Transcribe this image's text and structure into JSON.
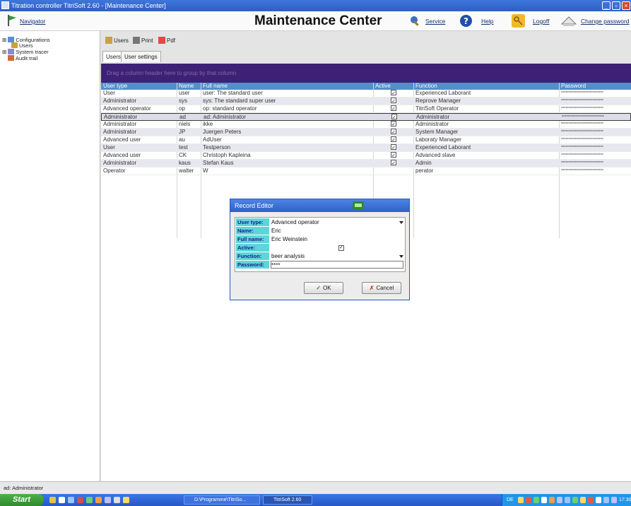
{
  "window": {
    "title": "Titration controller TitriSoft 2.60 - [Maintenance Center]"
  },
  "header": {
    "navigator_label": "Navigator",
    "page_title": "Maintenance Center",
    "service_label": "Service",
    "help_label": "Help",
    "logoff_label": "Logoff",
    "change_password_label": "Change password"
  },
  "nav": {
    "items": [
      {
        "label": "Configurations"
      },
      {
        "label": "Users"
      },
      {
        "label": "System tracer"
      },
      {
        "label": "Audit trail"
      }
    ]
  },
  "toolbar": {
    "users_label": "Users",
    "print_label": "Print",
    "pdf_label": "Pdf"
  },
  "tabs": [
    {
      "label": "Users"
    },
    {
      "label": "User settings"
    }
  ],
  "grid": {
    "group_hint": "Drag a column header here to group by that column",
    "columns": [
      "User type",
      "Name",
      "Full name",
      "Active",
      "Function",
      "Password"
    ],
    "rows": [
      {
        "type": "User",
        "name": "user",
        "full": "user: The standard user",
        "active": true,
        "function": "Experienced Laborant",
        "password": "****************************"
      },
      {
        "type": "Administrator",
        "name": "sys",
        "full": "sys: The standard super user",
        "active": true,
        "function": "Reprove Manager",
        "password": "****************************"
      },
      {
        "type": "Advanced operator",
        "name": "op",
        "full": "op: standard operator",
        "active": true,
        "function": "TitriSoft Operator",
        "password": "****************************"
      },
      {
        "type": "Administrator",
        "name": "ad",
        "full": "ad: Administrator",
        "active": true,
        "function": "Administrator",
        "password": "****************************"
      },
      {
        "type": "Administrator",
        "name": "niels",
        "full": "ikke",
        "active": true,
        "function": "Administrator",
        "password": "****************************"
      },
      {
        "type": "Administrator",
        "name": "JP",
        "full": "Juergen Peters",
        "active": true,
        "function": "System Manager",
        "password": "****************************"
      },
      {
        "type": "Advanced user",
        "name": "au",
        "full": "AdUser",
        "active": true,
        "function": "Laboraty Manager",
        "password": "****************************"
      },
      {
        "type": "User",
        "name": "test",
        "full": "Testperson",
        "active": true,
        "function": "Experienced Laborant",
        "password": "****************************"
      },
      {
        "type": "Advanced user",
        "name": "CK",
        "full": "Christoph Kapleina",
        "active": true,
        "function": "Advanced slave",
        "password": "****************************"
      },
      {
        "type": "Administrator",
        "name": "kaus",
        "full": "Stefan Kaus",
        "active": true,
        "function": "Admin",
        "password": "****************************"
      },
      {
        "type": "Operator",
        "name": "walter",
        "full": "W",
        "active": false,
        "function": "perator",
        "password": "****************************"
      }
    ]
  },
  "dialog": {
    "title": "Record Editor",
    "fields": [
      {
        "label": "User type:",
        "value": "Advanced operator"
      },
      {
        "label": "Name:",
        "value": "Eric"
      },
      {
        "label": "Full name:",
        "value": "Eric Weinstein"
      },
      {
        "label": "Active:",
        "value": ""
      },
      {
        "label": "Function:",
        "value": "beer analysis"
      },
      {
        "label": "Password:",
        "value": "****"
      }
    ],
    "ok_label": "OK",
    "cancel_label": "Cancel"
  },
  "status": {
    "text": "ad: Administrator"
  },
  "taskbar": {
    "start_label": "Start",
    "tasks": [
      {
        "label": "D:\\Programme\\TitriSo..."
      },
      {
        "label": "TitriSoft 2.60"
      }
    ],
    "tray_lang": "DE",
    "clock": "17:30"
  },
  "colors": {
    "grid_header": "#548fc9",
    "group_bar": "#3d2176",
    "field_label": "#5fd5d9",
    "titlebar": "#2d5fc4"
  }
}
